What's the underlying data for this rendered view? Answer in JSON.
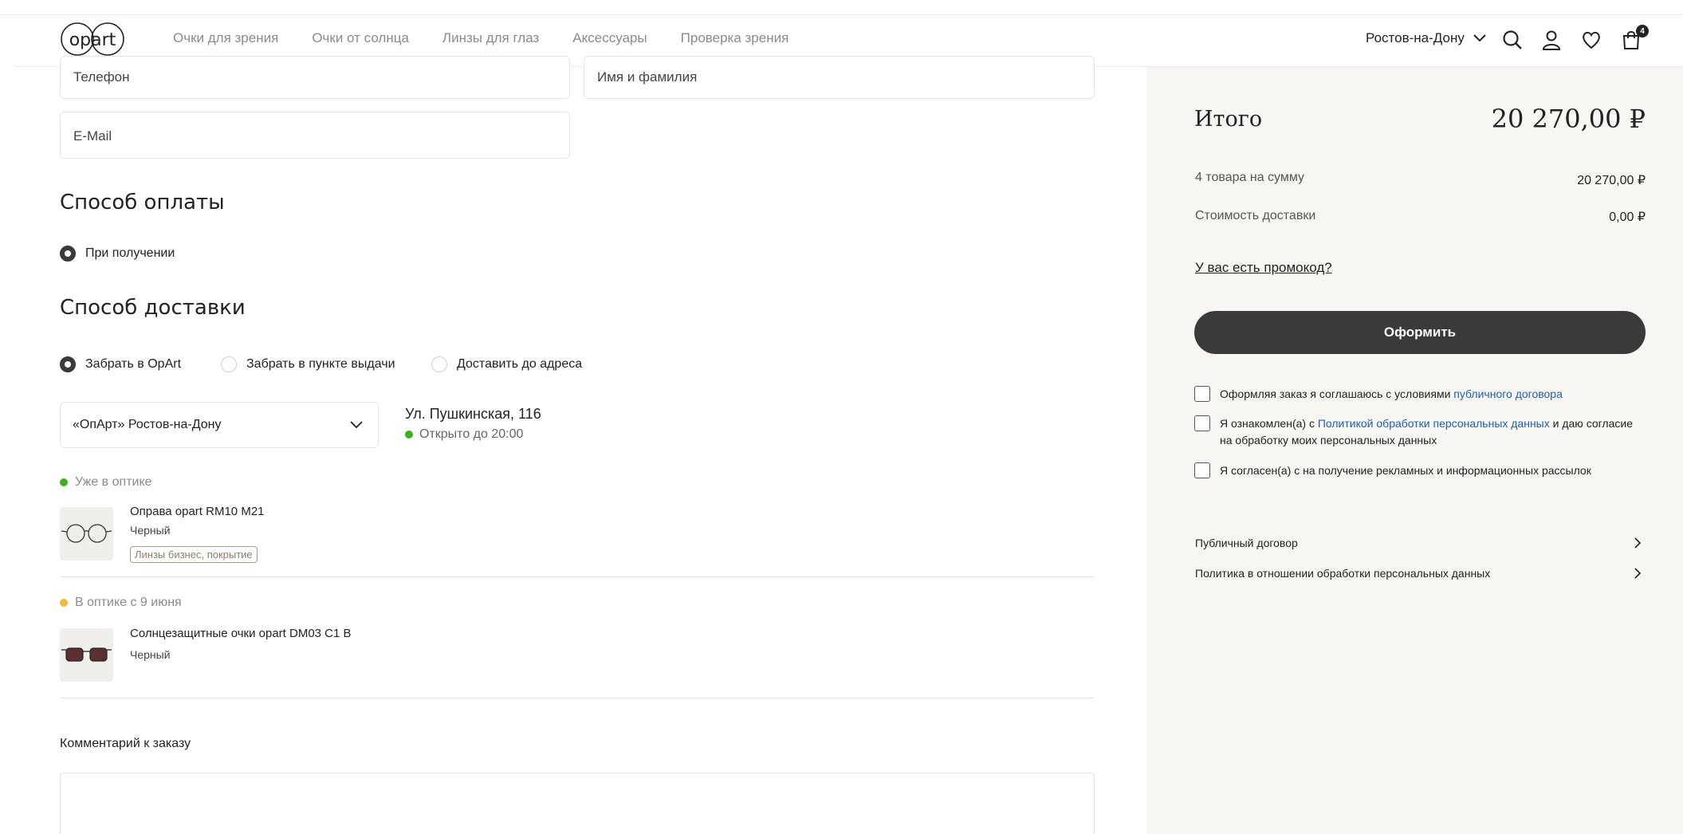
{
  "header": {
    "logo_text": "opart",
    "nav": [
      "Очки для зрения",
      "Очки от солнца",
      "Линзы для глаз",
      "Аксессуары",
      "Проверка зрения"
    ],
    "city": "Ростов-на-Дону",
    "cart_count": "4"
  },
  "contacts": {
    "phone_placeholder": "Телефон",
    "name_placeholder": "Имя и фамилия",
    "email_placeholder": "E-Mail"
  },
  "payment": {
    "title": "Способ оплаты",
    "options": [
      {
        "label": "При получении",
        "selected": true
      }
    ]
  },
  "delivery": {
    "title": "Способ доставки",
    "options": [
      {
        "label": "Забрать в OpArt",
        "selected": true
      },
      {
        "label": "Забрать в пункте выдачи",
        "selected": false
      },
      {
        "label": "Доставить до адреса",
        "selected": false
      }
    ],
    "store_select": "«ОпАрт» Ростов-на-Дону",
    "address": "Ул. Пушкинская, 116",
    "open_status": "Открыто до 20:00"
  },
  "items": [
    {
      "availability": "Уже в оптике",
      "name": "Оправа opart RM10 M21",
      "color": "Черный",
      "tag": "Линзы бизнес, покрытие"
    },
    {
      "availability": "В оптике с 9 июня",
      "name": "Солнцезащитные очки opart DM03 C1 B",
      "color": "Черный"
    }
  ],
  "comment": {
    "label": "Комментарий к заказу"
  },
  "summary": {
    "title": "Итого",
    "total": "20 270,00 ₽",
    "items_label": "4 товара на сумму",
    "items_value": "20 270,00 ₽",
    "delivery_label": "Стоимость доставки",
    "delivery_value": "0,00 ₽",
    "promo": "У вас есть промокод?",
    "submit": "Оформить",
    "consent1_text": "Оформляя заказ я соглашаюсь с условиями ",
    "consent1_link": "публичного договора",
    "consent2_pre": "Я ознакомлен(а) с ",
    "consent2_link": "Политикой обработки персональных данных",
    "consent2_post": " и даю согласие на обработку моих персональных данных",
    "consent3_text": "Я согласен(а) с на получение рекламных и информационных рассылок",
    "doc1": "Публичный договор",
    "doc2": "Политика в отношении обработки персональных данных"
  },
  "colors": {
    "accent_dark": "#3a3a3a",
    "link": "#1b5fb8",
    "panel_bg": "#f8f6f2",
    "open_green": "#3cb01a",
    "pending_yellow": "#f5b63a"
  }
}
